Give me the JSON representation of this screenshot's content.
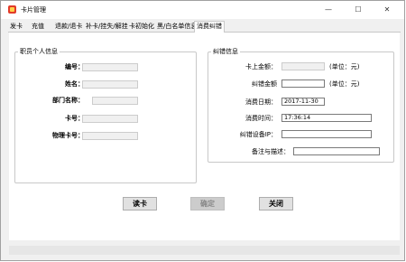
{
  "window": {
    "title": "卡片管理",
    "minimize": "—",
    "maximize": "☐",
    "close": "✕"
  },
  "tabs": [
    "发卡",
    "充值",
    "退款/退卡",
    "补卡/挂失/解挂",
    "卡初始化",
    "黑/白名单信息",
    "消费纠错"
  ],
  "active_tab_index": 6,
  "employee_group": {
    "title": "职员个人信息",
    "fields": [
      {
        "label": "编号：",
        "value": ""
      },
      {
        "label": "姓名：",
        "value": ""
      },
      {
        "label": "部门名称：",
        "value": ""
      },
      {
        "label": "卡号：",
        "value": ""
      },
      {
        "label": "物理卡号：",
        "value": ""
      }
    ]
  },
  "correction_group": {
    "title": "纠错信息",
    "balance": {
      "label": "卡上金额：",
      "value": "",
      "unit": "(单位：元)"
    },
    "amount": {
      "label": "纠错金额",
      "value": "",
      "unit": "(单位：元)"
    },
    "consume_date": {
      "label": "消费日期：",
      "value": "2017-11-30"
    },
    "consume_time": {
      "label": "消费时间：",
      "value": "17:36:14"
    },
    "device_ip": {
      "label": "纠错设备IP：",
      "value": ""
    },
    "remark": {
      "label": "备注与描述：",
      "value": ""
    }
  },
  "buttons": {
    "read_card": "读卡",
    "confirm": "确定",
    "close": "关闭"
  }
}
